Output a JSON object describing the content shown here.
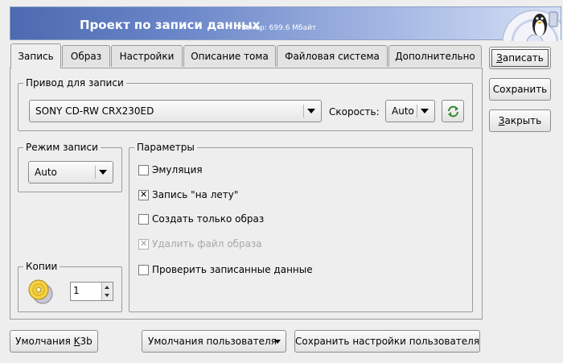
{
  "header": {
    "title": "Проект по записи данных",
    "size_label": "Размер: 699.6 Мбайт"
  },
  "tabs": [
    {
      "label": "Запись",
      "active": true
    },
    {
      "label": "Образ"
    },
    {
      "label": "Настройки"
    },
    {
      "label": "Описание тома"
    },
    {
      "label": "Файловая система"
    },
    {
      "label": "Дополнительно"
    }
  ],
  "drive_group": {
    "title": "Привод для записи",
    "drive": "SONY CD-RW  CRX230ED",
    "speed_label": "Скорость:",
    "speed": "Auto",
    "refresh_icon": "refresh-icon"
  },
  "mode_group": {
    "title": "Режим записи",
    "mode": "Auto"
  },
  "params_group": {
    "title": "Параметры",
    "options": [
      {
        "label": "Эмуляция",
        "checked": false,
        "enabled": true
      },
      {
        "label": "Запись \"на лету\"",
        "checked": true,
        "enabled": true
      },
      {
        "label": "Создать только образ",
        "checked": false,
        "enabled": true
      },
      {
        "label": "Удалить файл образа",
        "checked": true,
        "enabled": false
      },
      {
        "label": "Проверить записанные данные",
        "checked": false,
        "enabled": true
      }
    ]
  },
  "copies_group": {
    "title": "Копии",
    "icon": "cd-copies-icon",
    "value": "1"
  },
  "side_buttons": {
    "burn": {
      "text": "Записать",
      "mnemonic": "З"
    },
    "save": {
      "text": "Сохранить"
    },
    "close": {
      "text": "Закрыть",
      "mnemonic": "З"
    }
  },
  "bottom_buttons": {
    "k3b_defaults_prefix": "Умолчания ",
    "k3b_defaults_mnemonic": "K",
    "k3b_defaults_suffix": "3b",
    "user_defaults": "Умолчания пользователя",
    "save_user_defaults": "Сохранить настройки пользователя"
  },
  "colors": {
    "banner_start": "#4d6ab0",
    "banner_end": "#d6e0f4",
    "window_bg": "#eeeeee"
  }
}
